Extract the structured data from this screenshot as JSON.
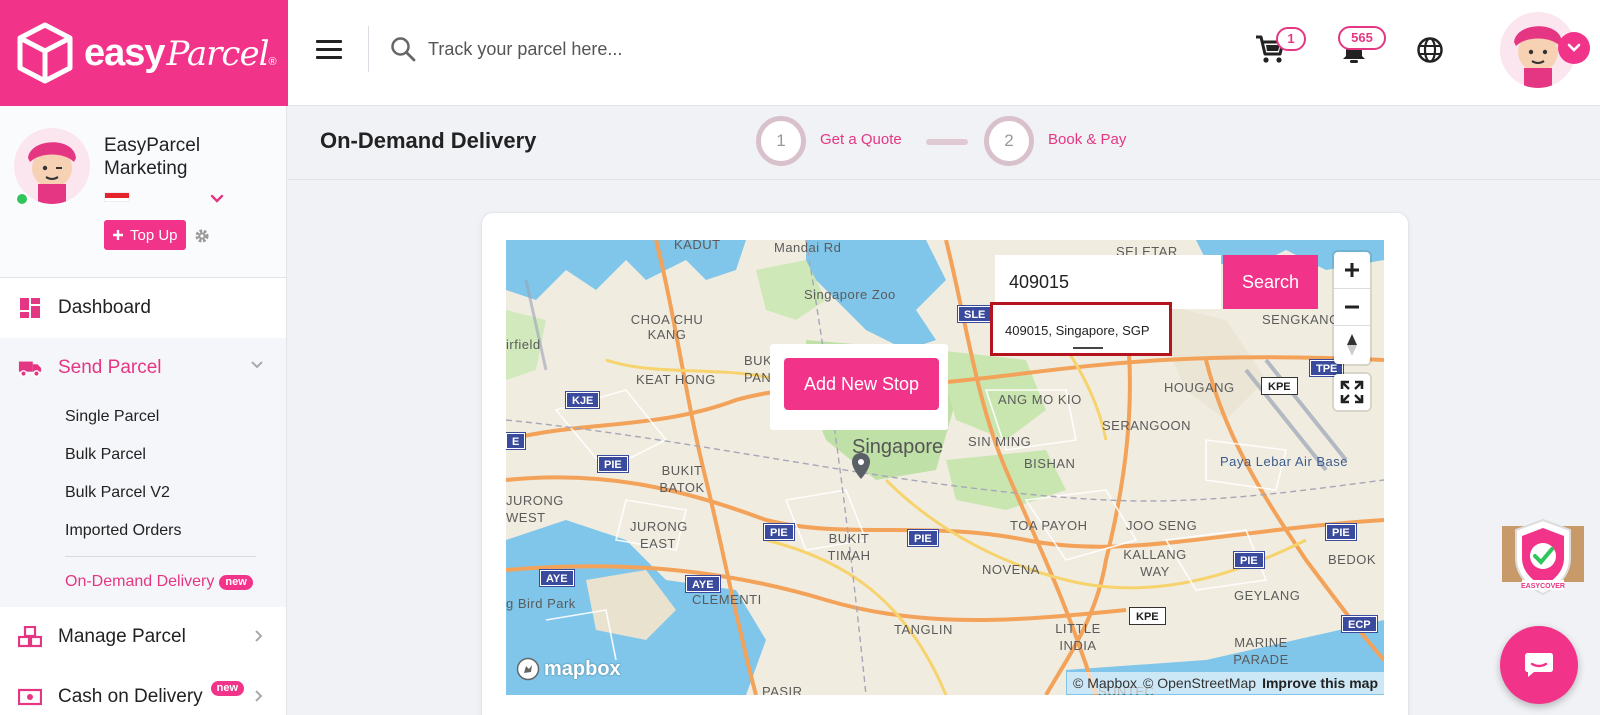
{
  "brand": {
    "name_bold": "easy",
    "name_script": "Parcel",
    "reg": "®"
  },
  "header": {
    "track_placeholder": "Track your parcel here...",
    "cart_count": "1",
    "notification_count": "565"
  },
  "profile": {
    "name": "EasyParcel Marketing",
    "topup_label": "Top Up"
  },
  "sidebar": {
    "dashboard": "Dashboard",
    "send_parcel": "Send Parcel",
    "send_parcel_sub": [
      "Single Parcel",
      "Bulk Parcel",
      "Bulk Parcel V2",
      "Imported Orders"
    ],
    "on_demand": "On-Demand Delivery",
    "new_badge": "new",
    "manage_parcel": "Manage Parcel",
    "cod": "Cash on Delivery"
  },
  "page": {
    "title": "On-Demand Delivery",
    "steps": [
      {
        "num": "1",
        "label": "Get a Quote"
      },
      {
        "num": "2",
        "label": "Book & Pay"
      }
    ]
  },
  "map": {
    "add_stop_label": "Add New Stop",
    "search_value": "409015",
    "search_button": "Search",
    "suggestion": "409015, Singapore, SGP",
    "mapbox_logo": "mapbox",
    "attribution_mapbox": "© Mapbox",
    "attribution_osm": "© OpenStreetMap",
    "improve": "Improve this map",
    "labels": {
      "kadut": "KADUT",
      "mandai": "Mandai Rd",
      "seletar": "SELETAR",
      "zoo": "Singapore Zoo",
      "choachukang": "CHOA CHU KANG",
      "sengkang": "SENGKANG",
      "airfield": "irfield",
      "keathong": "KEAT HONG",
      "bukit_panjang": "BUKIT PANJ",
      "hougang": "HOUGANG",
      "angmokio": "ANG MO KIO",
      "serangoon": "SERANGOON",
      "singapore": "Singapore",
      "sinming": "SIN MING",
      "bishan": "BISHAN",
      "bukitbatok": "BUKIT BATOK",
      "jurongwest": "JURONG WEST",
      "jurongeast": "JURONG EAST",
      "paya": "Paya Lebar Air Base",
      "toapayoh": "TOA PAYOH",
      "jooseng": "JOO SENG",
      "bukittimah": "BUKIT TIMAH",
      "kallangway": "KALLANG WAY",
      "bedok": "BEDOK",
      "novena": "NOVENA",
      "birdpark": "g Bird Park",
      "clementi": "CLEMENTI",
      "geylang": "GEYLANG",
      "tanglin": "TANGLIN",
      "littleindia": "LITTLE INDIA",
      "marineparade": "MARINE PARADE",
      "pasir": "PASIR",
      "suntec": "SUNTEC"
    },
    "shields": {
      "sle": "SLE",
      "kje": "KJE",
      "pie": "PIE",
      "tpe": "TPE",
      "kpe": "KPE",
      "aye": "AYE",
      "ecp": "ECP",
      "e": "E"
    }
  },
  "icons": {
    "cart": "cart-icon",
    "bell": "notification-icon",
    "globe": "globe-icon",
    "search": "search-icon",
    "menu": "menu-icon"
  },
  "colors": {
    "brand_pink": "#f2338a",
    "active_text": "#e53683",
    "online": "#2ec55a"
  }
}
